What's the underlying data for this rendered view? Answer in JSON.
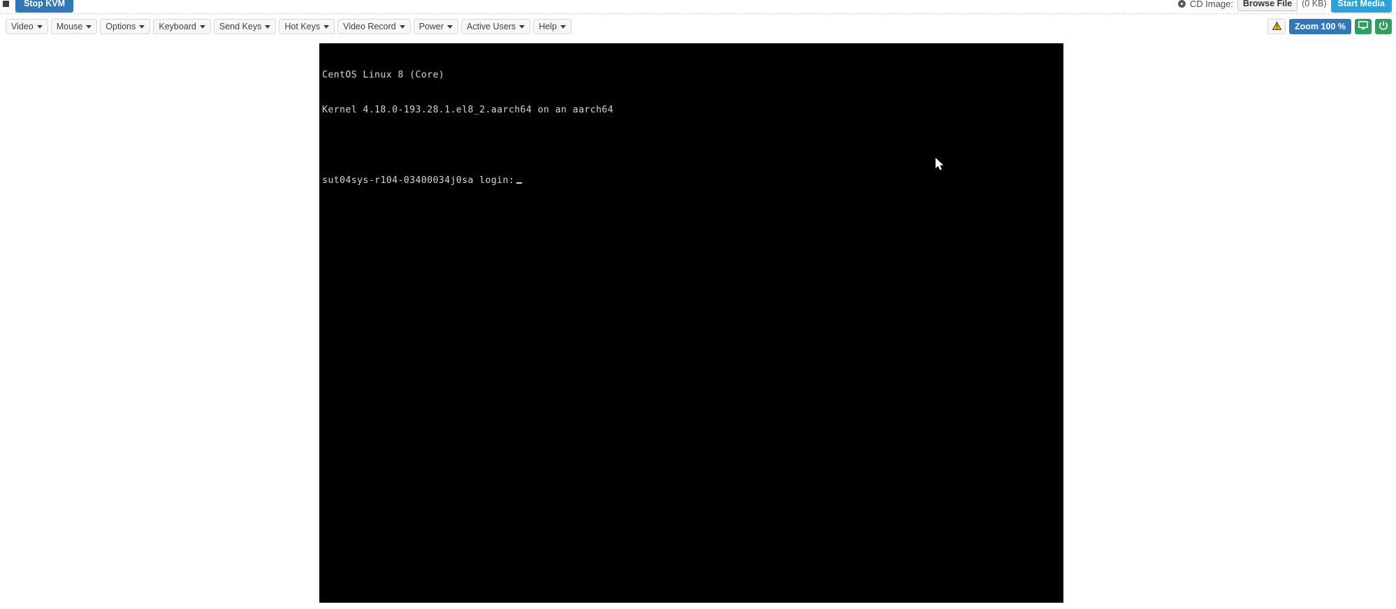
{
  "top_bar": {
    "kvm_icon": "monitor-square-icon",
    "stop_kvm_label": "Stop KVM",
    "cd_icon": "cd-disc-icon",
    "cd_image_label": "CD Image:",
    "browse_file_label": "Browse File",
    "cd_size_label": "(0 KB)",
    "start_media_label": "Start Media"
  },
  "menubar": {
    "items": [
      {
        "label": "Video"
      },
      {
        "label": "Mouse"
      },
      {
        "label": "Options"
      },
      {
        "label": "Keyboard"
      },
      {
        "label": "Send Keys"
      },
      {
        "label": "Hot Keys"
      },
      {
        "label": "Video Record"
      },
      {
        "label": "Power"
      },
      {
        "label": "Active Users"
      },
      {
        "label": "Help"
      }
    ],
    "right": {
      "warning_icon": "warning-triangle-icon",
      "zoom_label": "Zoom 100 %",
      "monitor_icon": "monitor-icon",
      "power_icon": "power-icon"
    }
  },
  "console": {
    "line1": "CentOS Linux 8 (Core)",
    "line2": "Kernel 4.18.0-193.28.1.el8_2.aarch64 on an aarch64",
    "line3": "",
    "line4_prompt": "sut04sys-r104-03400034j0sa login:",
    "cursor": "block-cursor",
    "background_color": "#000000",
    "text_color": "#d6d6d6",
    "pointer": "mouse-arrow-cursor"
  },
  "colors": {
    "accent_blue": "#3278b8",
    "media_blue": "#29a3dc",
    "green": "#2f9e5f",
    "toolbar_bg": "#f7f7f7",
    "page_bg": "#ffffff"
  }
}
